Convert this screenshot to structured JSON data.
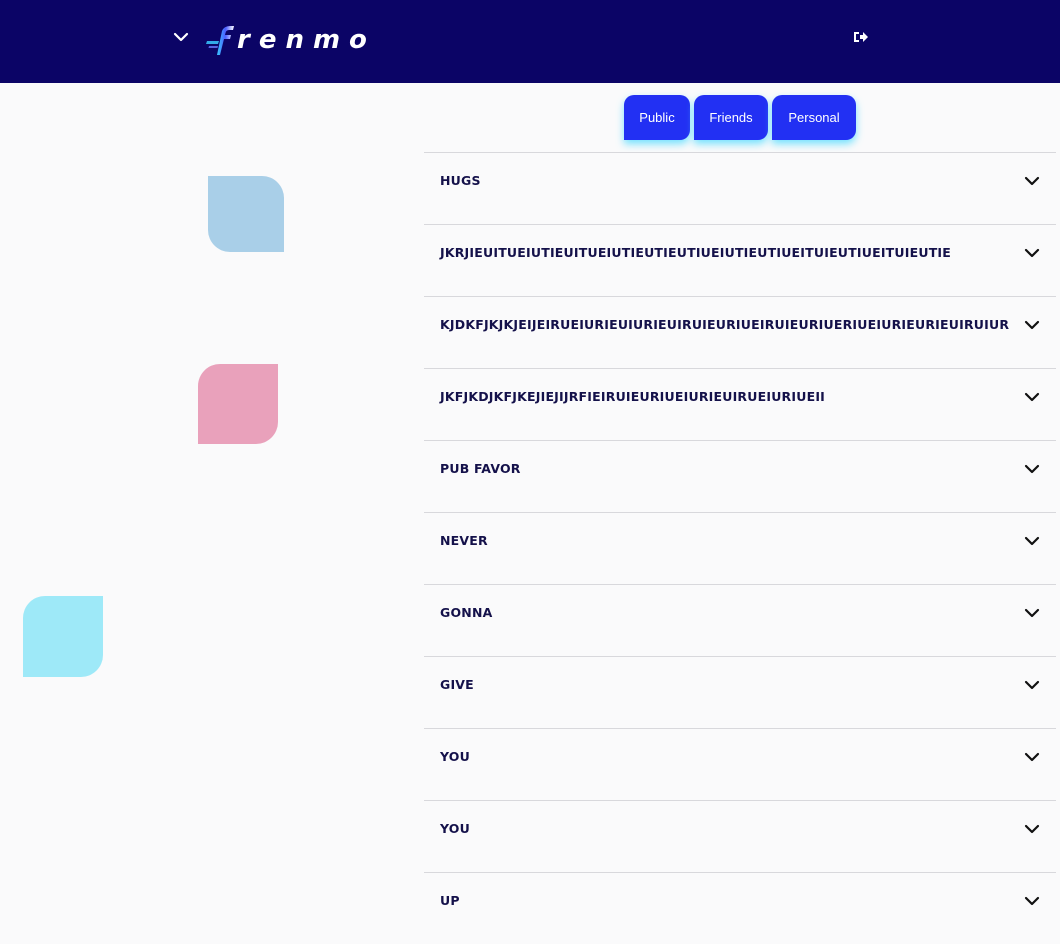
{
  "app": {
    "logo_text": "renmo",
    "colors": {
      "header_bg": "#0b0466",
      "tab_bg": "#2230f3",
      "row_text": "#14114a"
    }
  },
  "tabs": [
    {
      "label": "Public"
    },
    {
      "label": "Friends"
    },
    {
      "label": "Personal"
    }
  ],
  "list": {
    "items": [
      {
        "label": "HUGS"
      },
      {
        "label": "JKRJIEUITUEIUTIEUITUEIUTIEUTIEUTIUEIUTIEUTIUEITUIEUTIUEITUIEUTIE"
      },
      {
        "label": "KJDKFJKJKJEIJEIRUEIURIEUIURIEUIRUIEURIUEIRUIEURIUERIUEIURIEURIEUIRUIUR"
      },
      {
        "label": "JKFJKDJKFJKEJIEJIJRFIEIRUIEURIUEIURIEUIRUEIURIUEII"
      },
      {
        "label": "PUB FAVOR"
      },
      {
        "label": "NEVER"
      },
      {
        "label": "GONNA"
      },
      {
        "label": "GIVE"
      },
      {
        "label": "YOU"
      },
      {
        "label": "YOU"
      },
      {
        "label": "UP"
      }
    ]
  },
  "icons": {
    "menu": "chevron-down-icon",
    "logout": "logout-icon",
    "row": "chevron-down-icon"
  }
}
